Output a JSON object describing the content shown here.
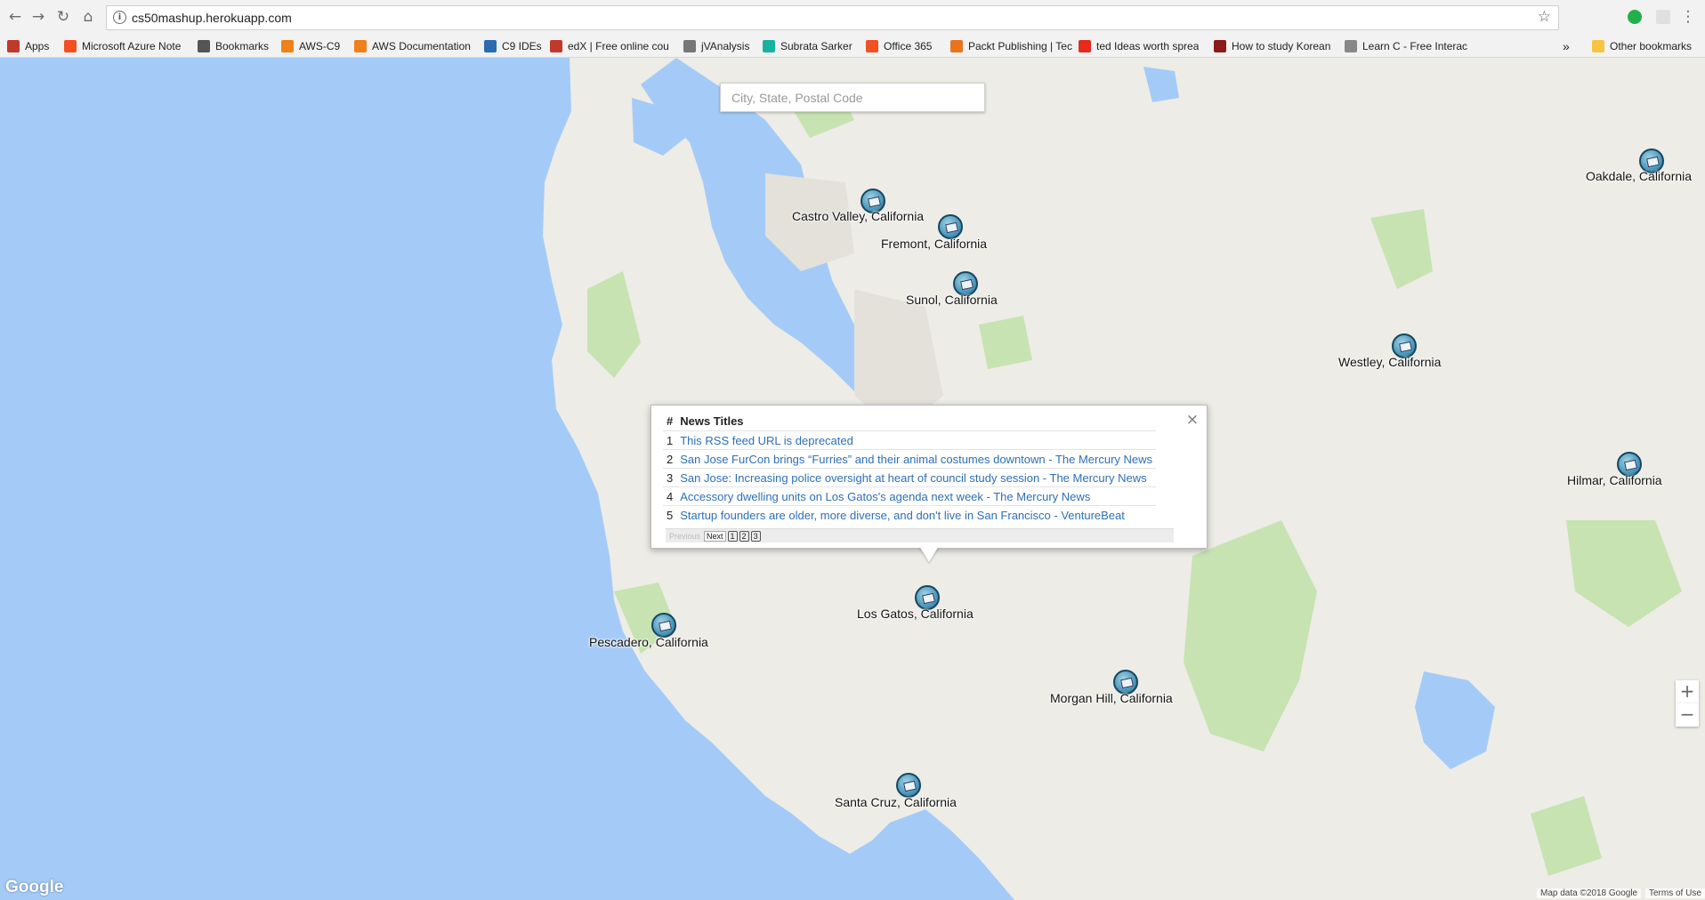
{
  "browser": {
    "url": "cs50mashup.herokuapp.com",
    "bookmarks": [
      {
        "label": "Apps",
        "icon": "apps-grid-icon",
        "color": "#c0392b"
      },
      {
        "label": "Microsoft Azure Note",
        "icon": "microsoft-icon",
        "color": "#f25022"
      },
      {
        "label": "Bookmarks",
        "icon": "star-icon",
        "color": "#555555"
      },
      {
        "label": "AWS-C9",
        "icon": "aws-icon",
        "color": "#f0801a"
      },
      {
        "label": "AWS Documentation",
        "icon": "aws-icon",
        "color": "#f0801a"
      },
      {
        "label": "C9 IDEs",
        "icon": "cloud9-icon",
        "color": "#2b6cb0"
      },
      {
        "label": "edX | Free online cou",
        "icon": "edx-icon",
        "color": "#c0392b"
      },
      {
        "label": "jVAnalysis",
        "icon": "chart-icon",
        "color": "#777777"
      },
      {
        "label": "Subrata Sarker",
        "icon": "researchgate-icon",
        "color": "#18b3a0"
      },
      {
        "label": "Office 365",
        "icon": "microsoft-icon",
        "color": "#f25022"
      },
      {
        "label": "Packt Publishing | Tec",
        "icon": "packt-icon",
        "color": "#e8741d"
      },
      {
        "label": "ted Ideas worth sprea",
        "icon": "ted-icon",
        "color": "#e62b1e"
      },
      {
        "label": "How to study Korean",
        "icon": "korean-icon",
        "color": "#8b1a1a"
      },
      {
        "label": "Learn C - Free Interac",
        "icon": "page-icon",
        "color": "#888888"
      }
    ],
    "overflow_label": "»",
    "other_bookmarks": "Other bookmarks"
  },
  "map": {
    "search_placeholder": "City, State, Postal Code",
    "markers": [
      {
        "label": "Castro Valley, California"
      },
      {
        "label": "Fremont, California"
      },
      {
        "label": "Sunol, California"
      },
      {
        "label": "Oakdale, California"
      },
      {
        "label": "Westley, California"
      },
      {
        "label": "Hilmar, California"
      },
      {
        "label": "Los Gatos, California"
      },
      {
        "label": "Pescadero, California"
      },
      {
        "label": "Morgan Hill, California"
      },
      {
        "label": "Santa Cruz, California"
      }
    ],
    "info_window": {
      "col_num": "#",
      "col_title": "News Titles",
      "rows": [
        {
          "num": "1",
          "title": "This RSS feed URL is deprecated"
        },
        {
          "num": "2",
          "title": "San Jose FurCon brings “Furries” and their animal costumes downtown - The Mercury News"
        },
        {
          "num": "3",
          "title": "San Jose: Increasing police oversight at heart of council study session - The Mercury News"
        },
        {
          "num": "4",
          "title": "Accessory dwelling units on Los Gatos's agenda next week - The Mercury News"
        },
        {
          "num": "5",
          "title": "Startup founders are older, more diverse, and don't live in San Francisco - VentureBeat"
        }
      ],
      "pager": {
        "previous": "Previous",
        "next": "Next",
        "pages": [
          "1",
          "2",
          "3"
        ]
      },
      "close": "×"
    },
    "zoom_in": "+",
    "zoom_out": "−",
    "logo": "Google",
    "attribution": "Map data ©2018 Google",
    "terms": "Terms of Use"
  }
}
